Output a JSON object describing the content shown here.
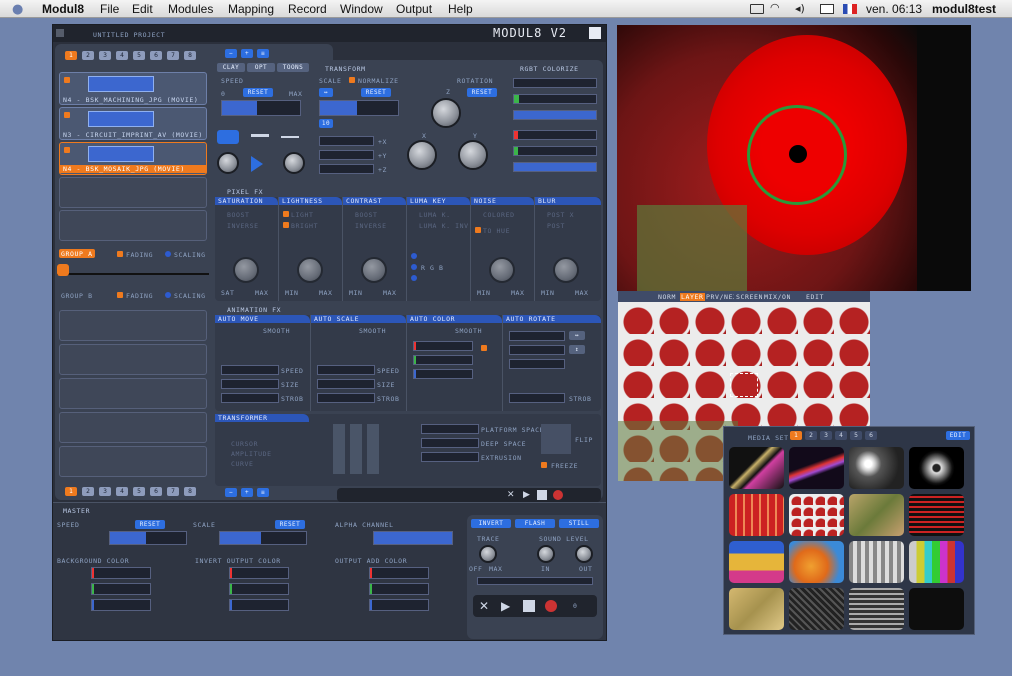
{
  "menubar": {
    "app": "Modul8",
    "items": [
      "File",
      "Edit",
      "Modules",
      "Mapping",
      "Record",
      "Window",
      "Output",
      "Help"
    ],
    "clock": "ven. 06:13",
    "user": "modul8test"
  },
  "main": {
    "project": "UNTITLED PROJECT",
    "logo": "MODUL8 V2",
    "layers": [
      "N4 - BSK_MACHINING_JPG (MOVIE)",
      "N3 - CIRCUIT_IMPRINT_AV (MOVIE)",
      "N4 - BSK_MOSAIK_JPG (MOVIE)"
    ],
    "layer_tabs": [
      "1",
      "2",
      "3",
      "4",
      "5",
      "6",
      "7",
      "8"
    ],
    "group_a": "GROUP A",
    "group_b": "GROUP B",
    "fading": "FADING",
    "scaling": "SCALING",
    "tabs": [
      "CLAY",
      "OPT",
      "TOONS"
    ],
    "transform": {
      "title": "TRANSFORM",
      "speed": "SPEED",
      "scale": "SCALE",
      "normalize": "NORMALIZE",
      "rotation": "ROTATION",
      "reset": "RESET",
      "min": "0",
      "max": "MAX",
      "x": "X",
      "y": "Y",
      "z": "Z",
      "px": "+X",
      "py": "+Y",
      "pz": "+Z"
    },
    "rgbt": "RGBT COLORIZE",
    "pixel_fx": {
      "title": "PIXEL FX",
      "cols": [
        {
          "name": "SATURATION",
          "a": "BOOST",
          "b": "INVERSE",
          "k": "SAT",
          "m": "MAX"
        },
        {
          "name": "LIGHTNESS",
          "a": "LIGHT",
          "b": "BRIGHT",
          "k": "MIN",
          "m": "MAX"
        },
        {
          "name": "CONTRAST",
          "a": "BOOST",
          "b": "INVERSE",
          "k": "MIN",
          "m": "MAX"
        },
        {
          "name": "LUMA KEY",
          "a": "LUMA K.",
          "b": "LUMA K. INV",
          "k": "R G B",
          "m": ""
        },
        {
          "name": "NOISE",
          "a": "COLORED",
          "b": "TO HUE",
          "k": "MIN",
          "m": "MAX"
        },
        {
          "name": "BLUR",
          "a": "POST X",
          "b": "POST",
          "k": "MIN",
          "m": "MAX"
        }
      ]
    },
    "anim_fx": {
      "title": "ANIMATION FX",
      "cols": [
        "AUTO MOVE",
        "AUTO SCALE",
        "AUTO COLOR",
        "AUTO ROTATE"
      ],
      "smooth": "SMOOTH",
      "speed": "SPEED",
      "size": "SIZE",
      "strob": "STROB"
    },
    "transformer": {
      "title": "TRANSFORMER",
      "a": "CURSOR",
      "b": "AMPLITUDE",
      "c": "CURVE",
      "labels": [
        "PLATFORM SPACE",
        "DEEP SPACE",
        "EXTRUSION"
      ],
      "flip": "FLIP",
      "freeze": "FREEZE"
    },
    "master": {
      "title": "MASTER",
      "speed": "SPEED",
      "scale": "SCALE",
      "alpha": "ALPHA CHANNEL",
      "reset": "RESET",
      "bg": "BACKGROUND COLOR",
      "inv": "INVERT OUTPUT COLOR",
      "add": "OUTPUT ADD COLOR",
      "invert": "INVERT",
      "flash": "FLASH",
      "still": "STILL",
      "trace": "TRACE",
      "sound": "SOUND LEVEL",
      "off": "OFF",
      "max": "MAX",
      "in": "IN",
      "out": "OUT",
      "counter": "0"
    }
  },
  "preview": {
    "toolbar": [
      "NORM",
      "LAYER",
      "PRV/NEXT HV",
      "SCREEN OV",
      "MIX/ONLY",
      "EDIT"
    ]
  },
  "media": {
    "title": "MEDIA SET",
    "tabs": [
      "1",
      "2",
      "3",
      "4",
      "5",
      "6"
    ],
    "edit": "EDIT"
  },
  "colors": {
    "orange": "#ef7a1e",
    "blue": "#2d6ee0",
    "panel": "#363d4d"
  }
}
